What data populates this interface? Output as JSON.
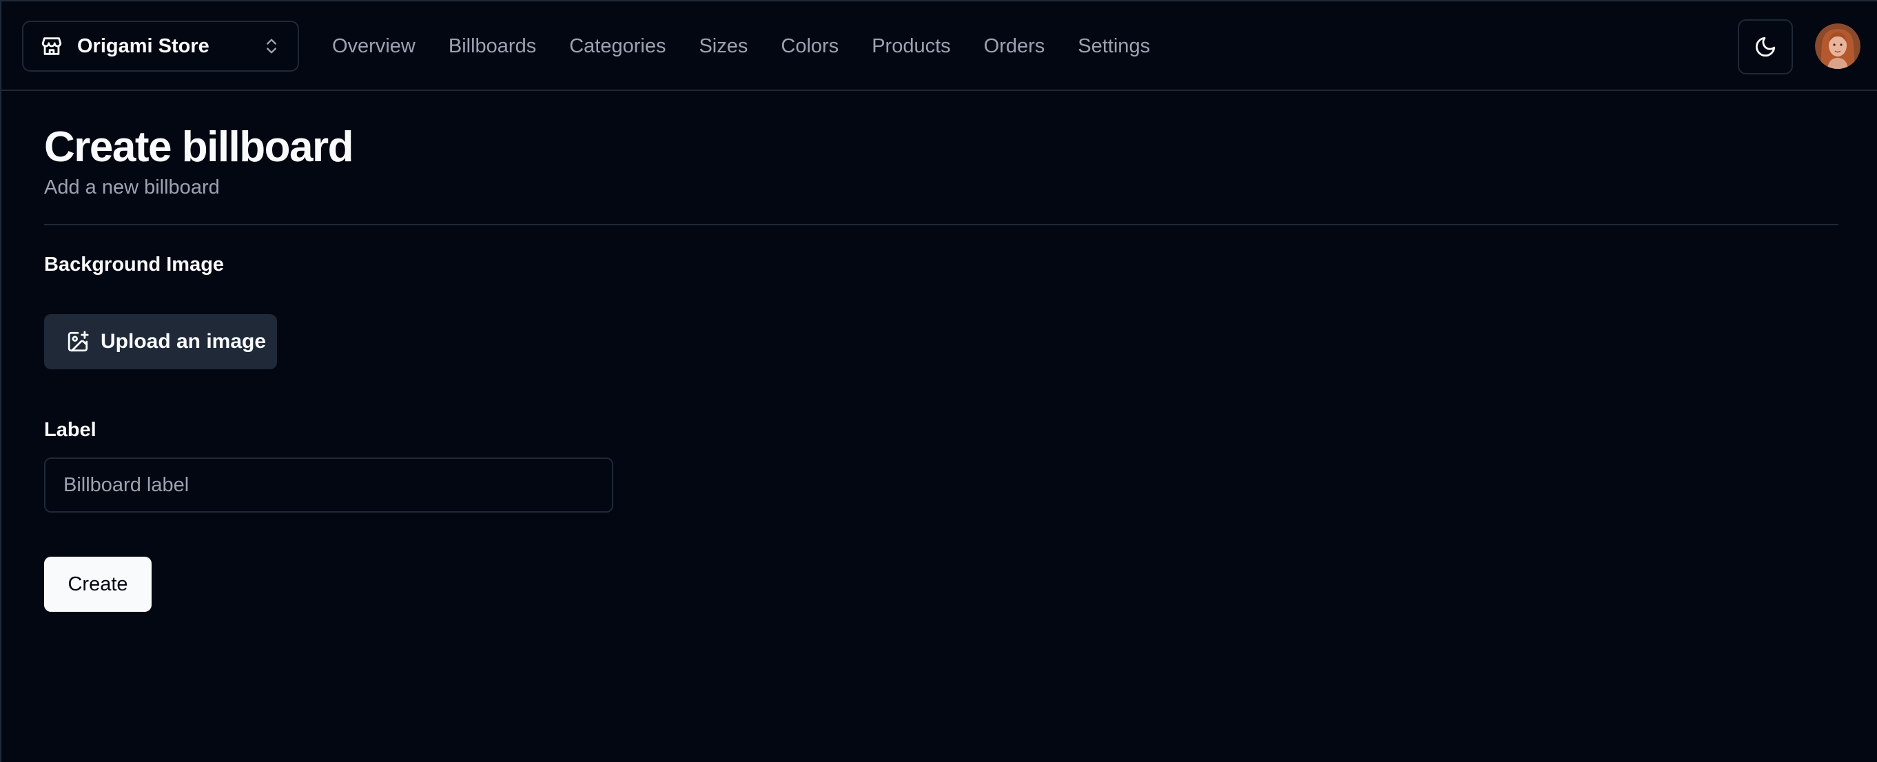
{
  "navbar": {
    "store_switcher": {
      "name": "Origami Store",
      "icon": "store-icon",
      "toggle_icon": "chevrons-up-down-icon"
    },
    "links": [
      {
        "label": "Overview"
      },
      {
        "label": "Billboards"
      },
      {
        "label": "Categories"
      },
      {
        "label": "Sizes"
      },
      {
        "label": "Colors"
      },
      {
        "label": "Products"
      },
      {
        "label": "Orders"
      },
      {
        "label": "Settings"
      }
    ],
    "theme_toggle_icon": "moon-icon",
    "avatar_icon": "user-avatar"
  },
  "main": {
    "title": "Create billboard",
    "subtitle": "Add a new billboard",
    "background_image": {
      "label": "Background Image",
      "upload_label": "Upload an image",
      "upload_icon": "image-plus-icon"
    },
    "label_field": {
      "label": "Label",
      "value": "",
      "placeholder": "Billboard label"
    },
    "submit_label": "Create"
  },
  "colors": {
    "background": "#030712",
    "border": "#1f2937",
    "muted_text": "#9ca3af",
    "primary_button": "#f9fafb",
    "secondary_button": "#1f2937"
  }
}
